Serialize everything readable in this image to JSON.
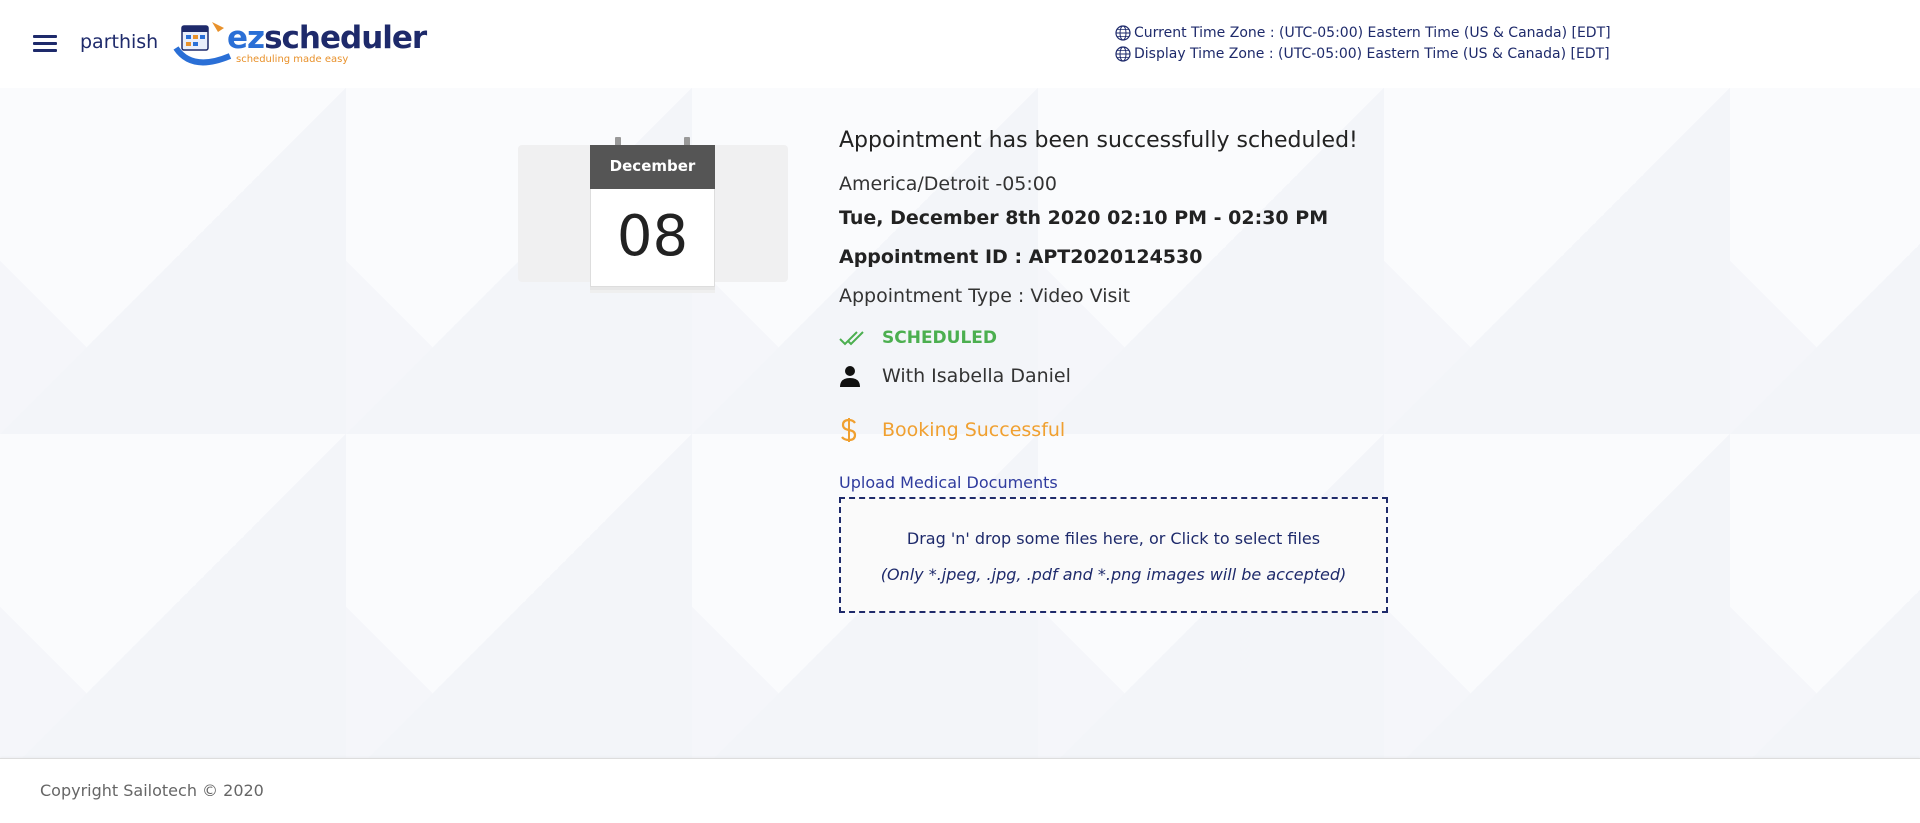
{
  "header": {
    "username": "parthish",
    "logo": {
      "ez": "ez",
      "rest": "scheduler",
      "tagline": "scheduling made easy"
    },
    "current_tz": "Current Time Zone : (UTC-05:00) Eastern Time (US & Canada) [EDT]",
    "display_tz": "Display Time Zone : (UTC-05:00) Eastern Time (US & Canada) [EDT]"
  },
  "calendar": {
    "month": "December",
    "day": "08"
  },
  "appointment": {
    "title": "Appointment has been successfully scheduled!",
    "timezone": "America/Detroit -05:00",
    "datetime": "Tue, December 8th 2020 02:10 PM - 02:30 PM",
    "id": "Appointment ID : APT2020124530",
    "type": "Appointment Type : Video Visit",
    "status": "SCHEDULED",
    "with": "With Isabella Daniel",
    "booking": "Booking Successful"
  },
  "upload": {
    "label": "Upload Medical Documents",
    "main": "Drag 'n' drop some files here, or Click to select files",
    "note": "(Only *.jpeg, .jpg, .pdf and *.png images will be accepted)"
  },
  "footer": {
    "copyright": "Copyright Sailotech © 2020"
  },
  "colors": {
    "navy": "#1e2a6b",
    "green": "#4caf50",
    "orange": "#f0a030",
    "link": "#2f3b9e"
  },
  "icons": [
    "menu-icon",
    "globe-icon",
    "double-check-icon",
    "person-icon",
    "dollar-icon",
    "calendar-icon"
  ]
}
